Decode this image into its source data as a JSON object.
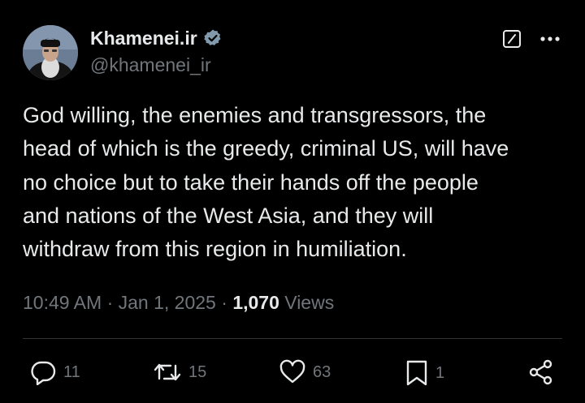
{
  "author": {
    "display_name": "Khamenei.ir",
    "handle": "@khamenei_ir",
    "verified": true,
    "verified_color": "#829aab"
  },
  "tweet": {
    "text": "God willing, the enemies and transgressors, the\nhead of which is the greedy, criminal US, will have\nno choice but to take their hands off the people\nand nations of the West Asia, and they will\nwithdraw from this region in humiliation."
  },
  "meta": {
    "time": "10:49 AM",
    "separator": "·",
    "date": "Jan 1, 2025",
    "views_count": "1,070",
    "views_label": "Views"
  },
  "actions": {
    "replies": "11",
    "reposts": "15",
    "likes": "63",
    "bookmarks": "1"
  },
  "icons": {
    "header": [
      "grok-icon",
      "more-icon"
    ],
    "actions": [
      "reply-icon",
      "repost-icon",
      "like-icon",
      "bookmark-icon",
      "share-icon"
    ]
  },
  "colors": {
    "background": "#000000",
    "text_primary": "#e7e9ea",
    "text_secondary": "#71767b",
    "divider": "#2f3336"
  }
}
